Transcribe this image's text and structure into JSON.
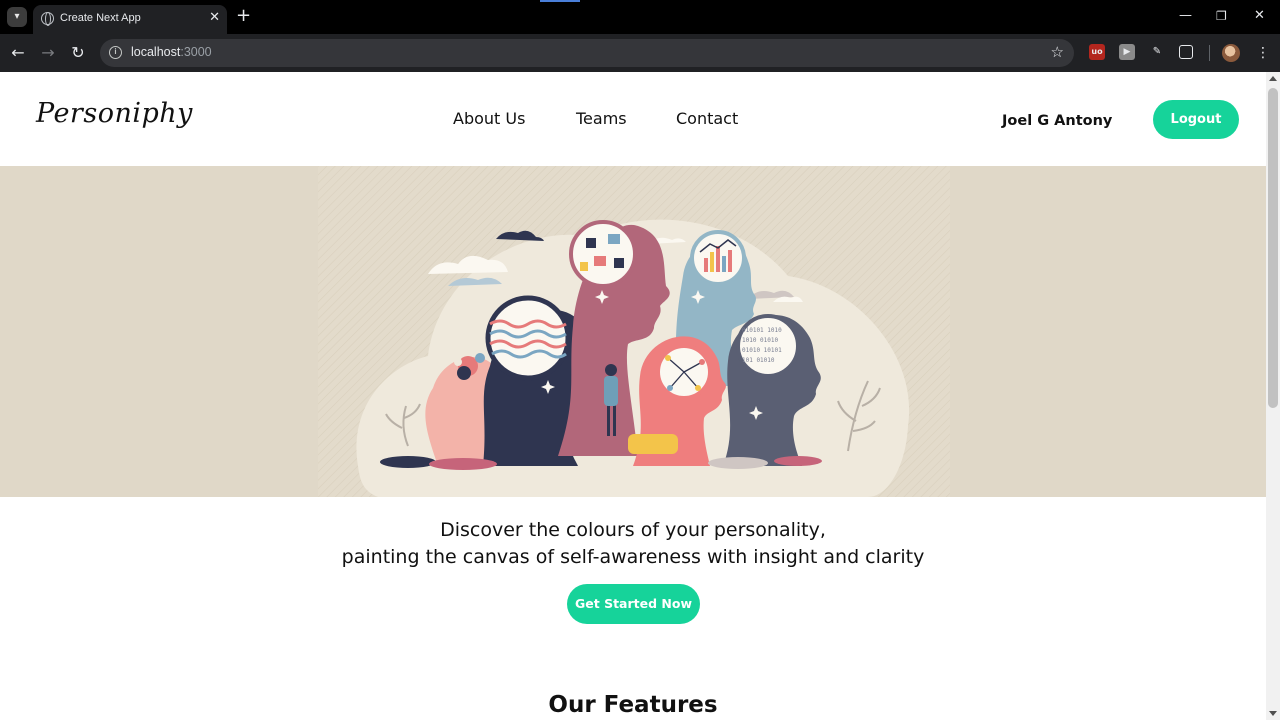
{
  "browser": {
    "tab_title": "Create Next App",
    "url_host": "localhost",
    "url_port": ":3000",
    "icons": [
      "tab-search-icon",
      "globe-icon",
      "close-icon",
      "plus-icon",
      "minimize-icon",
      "maximize-icon",
      "window-close-icon",
      "back-arrow-icon",
      "forward-arrow-icon",
      "reload-icon",
      "info-icon",
      "star-icon",
      "ublock-icon",
      "extension-icon",
      "eyedropper-icon",
      "puzzle-icon",
      "profile-avatar",
      "kebab-menu-icon"
    ]
  },
  "header": {
    "logo": "Personiphy",
    "nav": [
      "About Us",
      "Teams",
      "Contact"
    ],
    "user_name": "Joel G Antony",
    "logout_label": "Logout"
  },
  "hero": {
    "line1": "Discover the colours of your personality,",
    "line2": "painting the canvas of self-awareness with insight and clarity",
    "cta_label": "Get Started Now"
  },
  "features": {
    "title": "Our Features"
  },
  "colors": {
    "accent": "#16d39a",
    "hero_background": "#e0d8c8",
    "browser_dark": "#202124"
  }
}
